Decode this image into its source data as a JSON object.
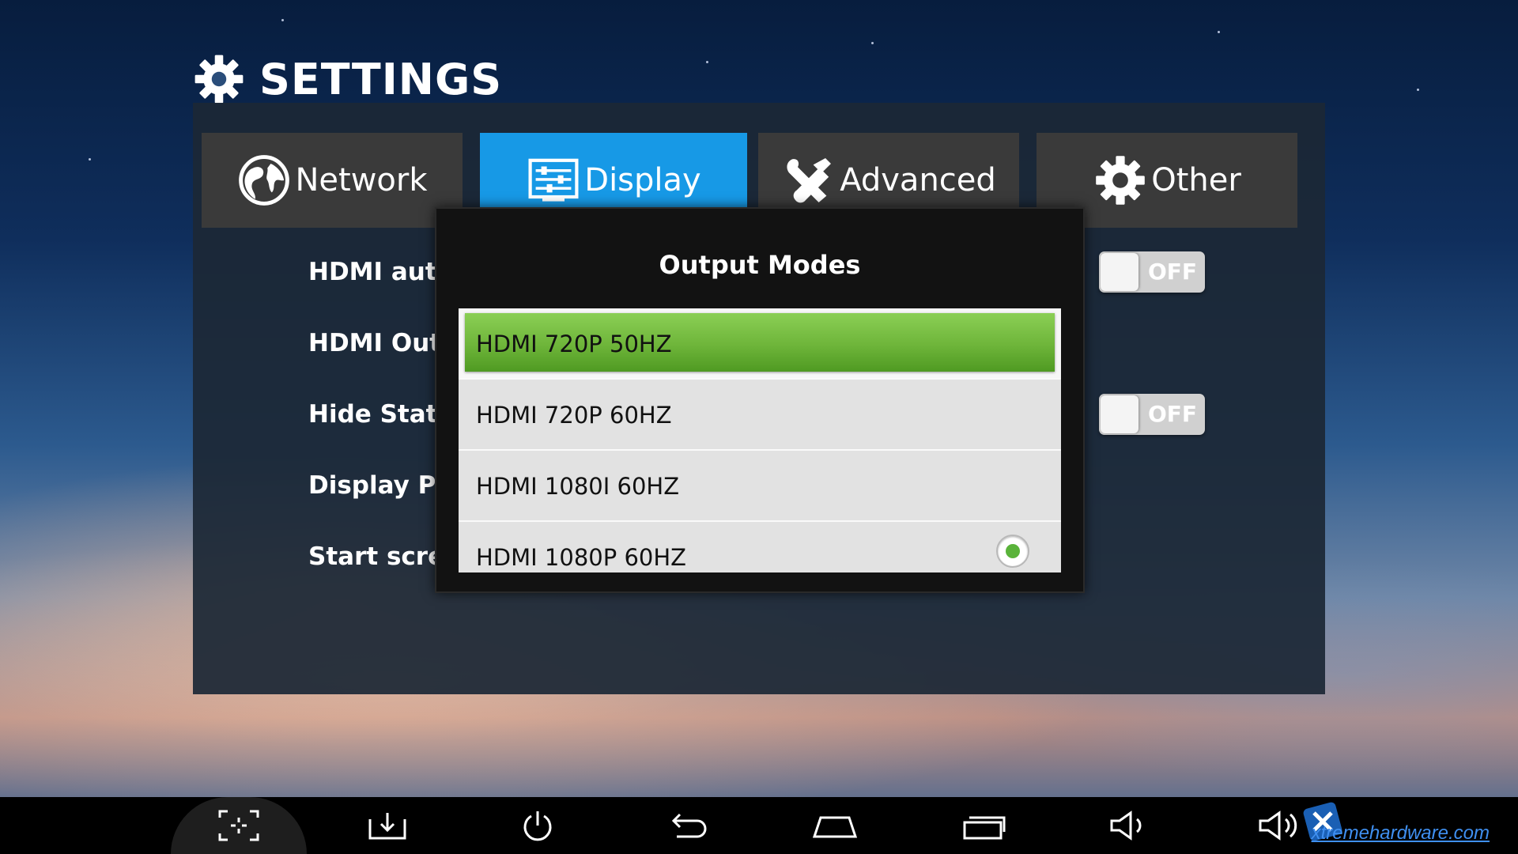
{
  "header": {
    "title": "SETTINGS",
    "icon": "gear-icon"
  },
  "tabs": [
    {
      "label": "Network",
      "icon": "globe-icon",
      "active": false
    },
    {
      "label": "Display",
      "icon": "display-settings-icon",
      "active": true
    },
    {
      "label": "Advanced",
      "icon": "tools-icon",
      "active": false
    },
    {
      "label": "Other",
      "icon": "gear-icon",
      "active": false
    }
  ],
  "settings": {
    "hdmi_auto_detection": {
      "label": "HDMI auto-detection",
      "toggle": "OFF"
    },
    "hdmi_output": {
      "label": "HDMI Outpu"
    },
    "hide_status_bar": {
      "label": "Hide Status",
      "toggle": "OFF"
    },
    "display_position": {
      "label": "Display Posi"
    },
    "start_screen": {
      "label": "Start scree"
    }
  },
  "dialog": {
    "title": "Output Modes",
    "options": [
      {
        "label": "HDMI 720P 50HZ",
        "focused": true,
        "checked": false
      },
      {
        "label": "HDMI 720P 60HZ",
        "focused": false,
        "checked": false
      },
      {
        "label": "HDMI 1080I 60HZ",
        "focused": false,
        "checked": false
      },
      {
        "label": "HDMI 1080P 60HZ",
        "focused": false,
        "checked": true
      }
    ]
  },
  "navbar": {
    "buttons": [
      "screenshot-icon",
      "download-icon",
      "power-icon",
      "back-icon",
      "home-icon",
      "recent-apps-icon",
      "volume-down-icon",
      "volume-up-icon"
    ],
    "watermark": "xtremehardware.com"
  },
  "colors": {
    "accent": "#1799e6",
    "selection": "#6eb53a"
  }
}
